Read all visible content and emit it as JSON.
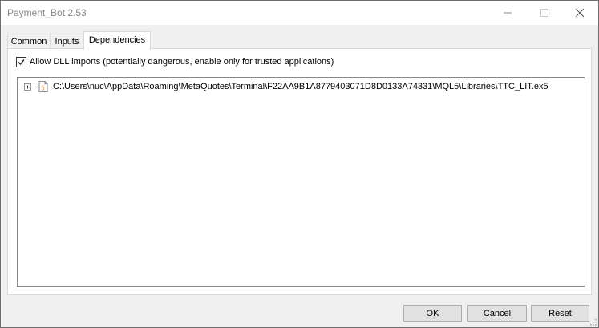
{
  "window": {
    "title": "Payment_Bot 2.53"
  },
  "tabs": [
    {
      "label": "Common"
    },
    {
      "label": "Inputs"
    },
    {
      "label": "Dependencies"
    }
  ],
  "active_tab": "Dependencies",
  "dependencies": {
    "allow_dll": {
      "label": "Allow DLL imports (potentially dangerous, enable only for trusted applications)",
      "checked": true
    },
    "tree_items": [
      {
        "label": "C:\\Users\\nuc\\AppData\\Roaming\\MetaQuotes\\Terminal\\F22AA9B1A8779403071D8D0133A74331\\MQL5\\Libraries\\TTC_LIT.ex5",
        "expanded": false,
        "icon": "mql5-file-icon"
      }
    ]
  },
  "buttons": {
    "ok": "OK",
    "cancel": "Cancel",
    "reset": "Reset"
  },
  "colors": {
    "window_bg": "#f0f0f0",
    "titlebar_text": "#8a8a8a",
    "button_bg": "#e1e1e1",
    "file_icon_accent": "#e8a33d"
  }
}
